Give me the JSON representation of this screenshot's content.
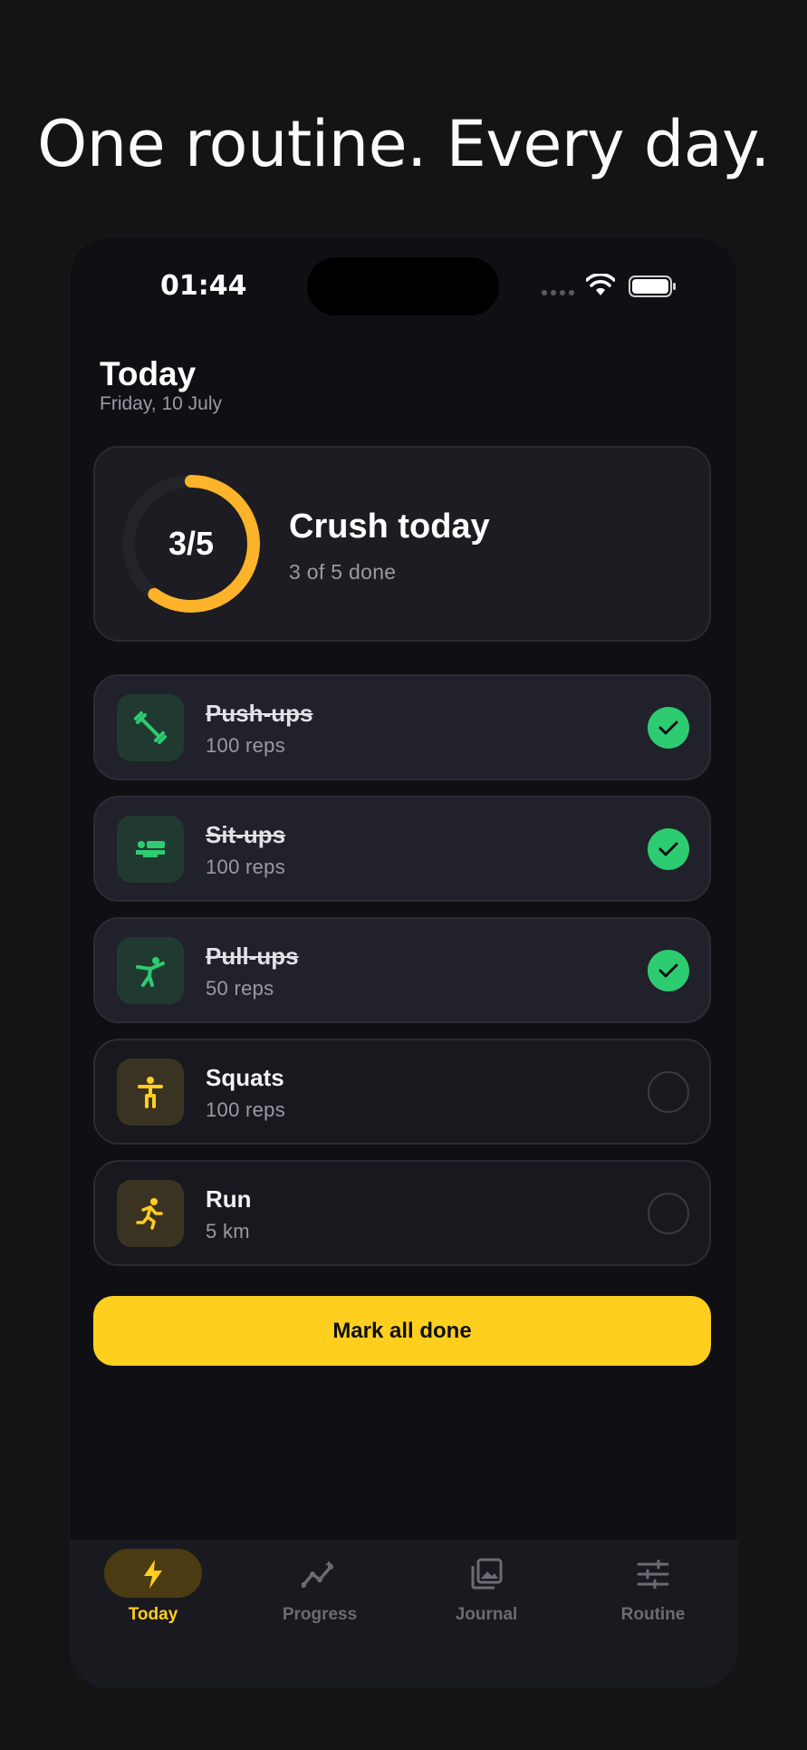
{
  "headline": "One routine. Every day.",
  "status_bar": {
    "time": "01:44"
  },
  "header": {
    "title": "Today",
    "date": "Friday, 10 July"
  },
  "summary": {
    "ring_label": "3/5",
    "progress": 0.6,
    "title": "Crush today",
    "subtitle": "3 of 5 done"
  },
  "tasks": [
    {
      "name": "Push-ups",
      "meta": "100 reps",
      "done": true,
      "icon": "dumbbell-icon"
    },
    {
      "name": "Sit-ups",
      "meta": "100 reps",
      "done": true,
      "icon": "bed-icon"
    },
    {
      "name": "Pull-ups",
      "meta": "50 reps",
      "done": true,
      "icon": "martial-arts-icon"
    },
    {
      "name": "Squats",
      "meta": "100 reps",
      "done": false,
      "icon": "person-standing-icon"
    },
    {
      "name": "Run",
      "meta": "5 km",
      "done": false,
      "icon": "running-icon"
    }
  ],
  "cta_label": "Mark all done",
  "tabs": [
    {
      "label": "Today",
      "icon": "bolt-icon",
      "active": true
    },
    {
      "label": "Progress",
      "icon": "trend-icon",
      "active": false
    },
    {
      "label": "Journal",
      "icon": "gallery-icon",
      "active": false
    },
    {
      "label": "Routine",
      "icon": "sliders-icon",
      "active": false
    }
  ],
  "colors": {
    "accent": "#fecf1f",
    "done_green": "#2ecc71",
    "ring": "#fdb32a",
    "background": "#0f0f14"
  }
}
